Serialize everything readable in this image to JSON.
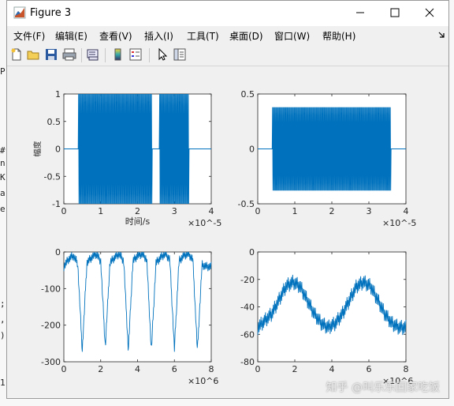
{
  "window": {
    "title": "Figure 3"
  },
  "menu": [
    "文件(F)",
    "编辑(E)",
    "查看(V)",
    "插入(I)",
    "工具(T)",
    "桌面(D)",
    "窗口(W)",
    "帮助(H)"
  ],
  "left_background": [
    "P",
    "#",
    "n",
    "K",
    "a",
    "e",
    ";",
    ",",
    ")",
    "1"
  ],
  "watermark": "知乎 @叫乐乐回家吃饭",
  "colors": {
    "series": "#0072bd",
    "figure_bg": "#f0f0f0"
  },
  "chart_data": [
    {
      "type": "line",
      "position": "top-left",
      "xlabel": "时间/s",
      "ylabel": "幅度",
      "xlim": [
        0,
        4
      ],
      "ylim": [
        -1,
        1
      ],
      "xticks": [
        "0",
        "1",
        "2",
        "3",
        "4"
      ],
      "yticks": [
        "-1",
        "-0.5",
        "0",
        "0.5",
        "1"
      ],
      "x_exponent": "×10^-5",
      "series": [
        {
          "values": [
            0,
            0,
            1,
            -1,
            1,
            -1,
            1,
            -1,
            1,
            -1,
            1,
            -1,
            0,
            1,
            -1,
            1,
            -1,
            0,
            0,
            0
          ]
        }
      ]
    },
    {
      "type": "line",
      "position": "top-right",
      "xlim": [
        0,
        4
      ],
      "ylim": [
        -0.5,
        0.5
      ],
      "xticks": [
        "0",
        "1",
        "2",
        "3",
        "4"
      ],
      "yticks": [
        "-0.5",
        "0",
        "0.5"
      ],
      "x_exponent": "×10^-5",
      "series": [
        {
          "values": [
            0,
            0,
            0.38,
            -0.38,
            0.38,
            -0.38,
            0.38,
            -0.38,
            0.38,
            -0.38,
            0.38,
            -0.38,
            0.38,
            -0.38,
            0.38,
            -0.38,
            0.38,
            -0.38,
            0,
            0
          ]
        }
      ]
    },
    {
      "type": "line",
      "position": "bottom-left",
      "xlim": [
        0,
        8
      ],
      "ylim": [
        -300,
        0
      ],
      "xticks": [
        "0",
        "2",
        "4",
        "6",
        "8"
      ],
      "yticks": [
        "-300",
        "-200",
        "-100",
        "0"
      ],
      "x_exponent": "×10^6",
      "series": [
        {
          "values": [
            -40,
            -20,
            -10,
            -30,
            -270,
            -30,
            -15,
            -5,
            -25,
            -260,
            -30,
            -15,
            -5,
            -25,
            -270,
            -25,
            -10,
            -5,
            -20,
            -270,
            -30,
            -15,
            -5,
            -20,
            -265,
            -25,
            -10,
            -5,
            -20,
            -270,
            -35,
            -40
          ]
        }
      ]
    },
    {
      "type": "line",
      "position": "bottom-right",
      "xlim": [
        0,
        8
      ],
      "ylim": [
        -80,
        0
      ],
      "xticks": [
        "0",
        "2",
        "4",
        "6",
        "8"
      ],
      "yticks": [
        "-80",
        "-60",
        "-40",
        "-20",
        "0"
      ],
      "x_exponent": "×10^6",
      "series": [
        {
          "values": [
            -55,
            -50,
            -45,
            -35,
            -25,
            -22,
            -25,
            -35,
            -45,
            -52,
            -55,
            -52,
            -45,
            -35,
            -25,
            -22,
            -25,
            -35,
            -45,
            -52,
            -55
          ]
        }
      ]
    }
  ]
}
